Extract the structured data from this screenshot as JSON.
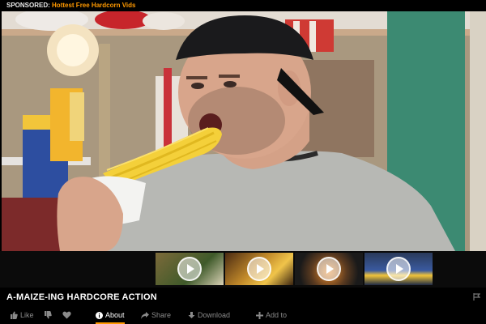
{
  "sponsored": {
    "lead_text": "SPONSORED:",
    "link_text": "Hottest Free Hardcorn Vids"
  },
  "video": {
    "title": "A-MAIZE-ING HARDCORE ACTION",
    "thumbnails": [
      {
        "name": "grilled-corn-on-board"
      },
      {
        "name": "corn-cobs-on-plate"
      },
      {
        "name": "corn-boiling-in-pot"
      },
      {
        "name": "corn-on-blue-plate"
      }
    ]
  },
  "actions": {
    "like_label": "Like",
    "about_label": "About",
    "share_label": "Share",
    "download_label": "Download",
    "addto_label": "Add to"
  },
  "colors": {
    "accent": "#ff9900",
    "background": "#000000",
    "muted_text": "#8a8a8a"
  },
  "icons": [
    "thumbs-up-icon",
    "thumbs-down-icon",
    "heart-icon",
    "info-icon",
    "share-icon",
    "download-icon",
    "plus-icon",
    "flag-icon",
    "play-icon"
  ]
}
